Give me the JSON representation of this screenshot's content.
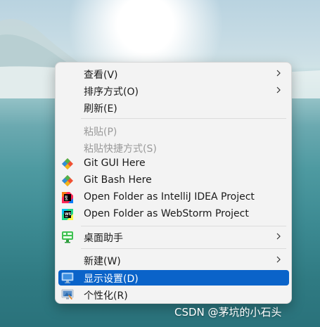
{
  "menu": {
    "items": [
      {
        "label": "查看(V)",
        "submenu": true
      },
      {
        "label": "排序方式(O)",
        "submenu": true
      },
      {
        "label": "刷新(E)"
      },
      {
        "label": "粘贴(P)",
        "disabled": true
      },
      {
        "label": "粘贴快捷方式(S)",
        "disabled": true
      },
      {
        "label": "Git GUI Here",
        "icon": "git-icon"
      },
      {
        "label": "Git Bash Here",
        "icon": "git-icon"
      },
      {
        "label": "Open Folder as IntelliJ IDEA Project",
        "icon": "intellij-idea-icon"
      },
      {
        "label": "Open Folder as WebStorm Project",
        "icon": "webstorm-icon"
      },
      {
        "label": "桌面助手",
        "icon": "desktop-assistant-icon",
        "submenu": true
      },
      {
        "label": "新建(W)",
        "submenu": true
      },
      {
        "label": "显示设置(D)",
        "icon": "display-settings-icon",
        "selected": true
      },
      {
        "label": "个性化(R)",
        "icon": "personalize-icon"
      }
    ]
  },
  "watermark": "CSDN @茅坑的小石头",
  "colors": {
    "selected": "#0a63c9",
    "menu_bg": "#f3f3f3",
    "disabled_text": "#9a9a9a"
  }
}
